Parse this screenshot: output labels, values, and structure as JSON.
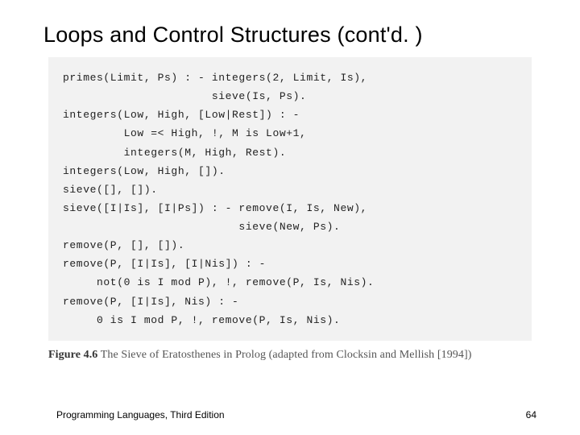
{
  "title": "Loops and Control Structures (cont'd. )",
  "code": {
    "lines": [
      "primes(Limit, Ps) : - integers(2, Limit, Is),",
      "                      sieve(Is, Ps).",
      "integers(Low, High, [Low|Rest]) : -",
      "         Low =< High, !, M is Low+1,",
      "         integers(M, High, Rest).",
      "integers(Low, High, []).",
      "sieve([], []).",
      "sieve([I|Is], [I|Ps]) : - remove(I, Is, New),",
      "                          sieve(New, Ps).",
      "remove(P, [], []).",
      "remove(P, [I|Is], [I|Nis]) : -",
      "     not(0 is I mod P), !, remove(P, Is, Nis).",
      "remove(P, [I|Is], Nis) : -",
      "     0 is I mod P, !, remove(P, Is, Nis)."
    ]
  },
  "figure": {
    "label": "Figure 4.6",
    "caption": "The Sieve of Eratosthenes in Prolog (adapted from Clocksin and Mellish [1994])"
  },
  "footer": {
    "book": "Programming Languages, Third Edition",
    "page": "64"
  }
}
